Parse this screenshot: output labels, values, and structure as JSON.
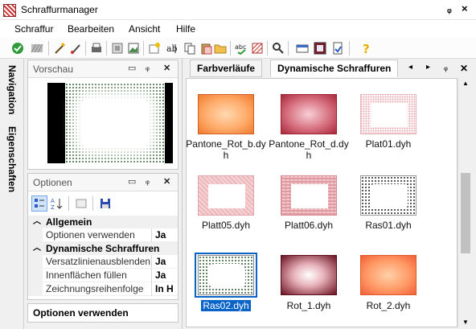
{
  "window": {
    "title": "Schraffurmanager",
    "pin_glyph": "ᵩ",
    "close_glyph": "×"
  },
  "menu": [
    "Schraffur",
    "Bearbeiten",
    "Ansicht",
    "Hilfe"
  ],
  "toolbar": {
    "icons": [
      "check-icon",
      "hatch-gray-icon",
      "wand-icon",
      "brush-icon",
      "print-icon",
      "preview-icon",
      "image-icon",
      "new-hatch-icon",
      "text-icon",
      "copy-icon",
      "paste-icon",
      "folder-icon",
      "spellcheck-icon",
      "hatch-red-icon",
      "search-icon",
      "window-icon",
      "frame-icon",
      "page-icon",
      "help-icon"
    ]
  },
  "side_tabs": {
    "navigation": "Navigation",
    "eigenschaften": "Eigenschaften"
  },
  "preview_panel": {
    "title": "Vorschau"
  },
  "options_panel": {
    "title": "Optionen",
    "categories": [
      {
        "label": "Allgemein",
        "rows": [
          {
            "name": "Optionen verwenden",
            "value": "Ja"
          }
        ]
      },
      {
        "label": "Dynamische Schraffuren",
        "rows": [
          {
            "name": "Versatzlinienausblenden",
            "value": "Ja"
          },
          {
            "name": "Innenflächen füllen",
            "value": "Ja"
          },
          {
            "name": "Zeichnungsreihenfolge",
            "value": "In H"
          }
        ]
      }
    ],
    "description": "Optionen verwenden"
  },
  "tabs": {
    "farbverlaeufe": "Farbverläufe",
    "dynamisch": "Dynamische Schraffuren"
  },
  "gallery": {
    "items": [
      {
        "label": "Pantone_Rot_b.dy\nh",
        "style": "orange"
      },
      {
        "label": "Pantone_Rot_d.dy\nh",
        "style": "red"
      },
      {
        "label": "Plat01.dyh",
        "style": "plat01"
      },
      {
        "label": "Platt05.dyh",
        "style": "plat05"
      },
      {
        "label": "Platt06.dyh",
        "style": "plat06"
      },
      {
        "label": "Ras01.dyh",
        "style": "ras"
      },
      {
        "label": "Ras02.dyh",
        "style": "ras2",
        "selected": true
      },
      {
        "label": "Rot_1.dyh",
        "style": "rot1"
      },
      {
        "label": "Rot_2.dyh",
        "style": "rot2"
      }
    ]
  },
  "colors": {
    "selection": "#0a64c8"
  }
}
